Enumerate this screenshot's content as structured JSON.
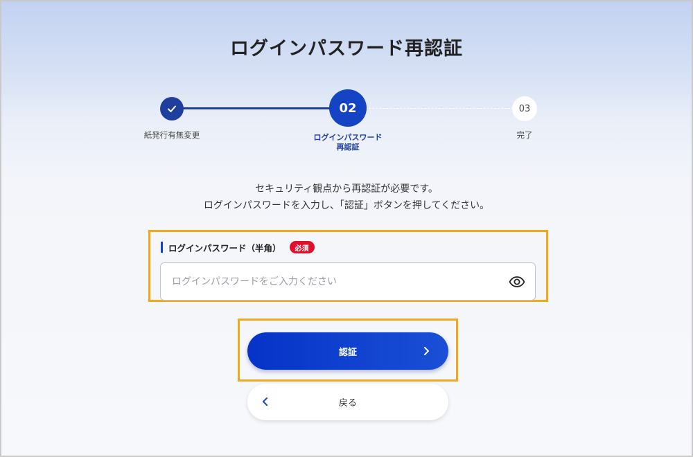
{
  "page": {
    "title": "ログインパスワード再認証"
  },
  "stepper": {
    "steps": [
      {
        "label": "紙発行有無変更",
        "status": "done"
      },
      {
        "number": "02",
        "label_line1": "ログインパスワード",
        "label_line2": "再認証",
        "status": "current"
      },
      {
        "number": "03",
        "label": "完了",
        "status": "todo"
      }
    ]
  },
  "description": {
    "line1": "セキュリティ観点から再認証が必要です。",
    "line2": "ログインパスワードを入力し、「認証」ボタンを押してください。"
  },
  "password_field": {
    "label": "ログインパスワード（半角）",
    "required_badge": "必須",
    "value": "",
    "placeholder": "ログインパスワードをご入力ください"
  },
  "buttons": {
    "submit_label": "認証",
    "back_label": "戻る"
  },
  "colors": {
    "primary": "#1444c4",
    "highlight": "#f2a81d",
    "required": "#e0102c"
  },
  "icons": {
    "step1": "check-icon",
    "password_toggle": "eye-icon",
    "submit": "chevron-right-icon",
    "back": "chevron-left-icon"
  }
}
